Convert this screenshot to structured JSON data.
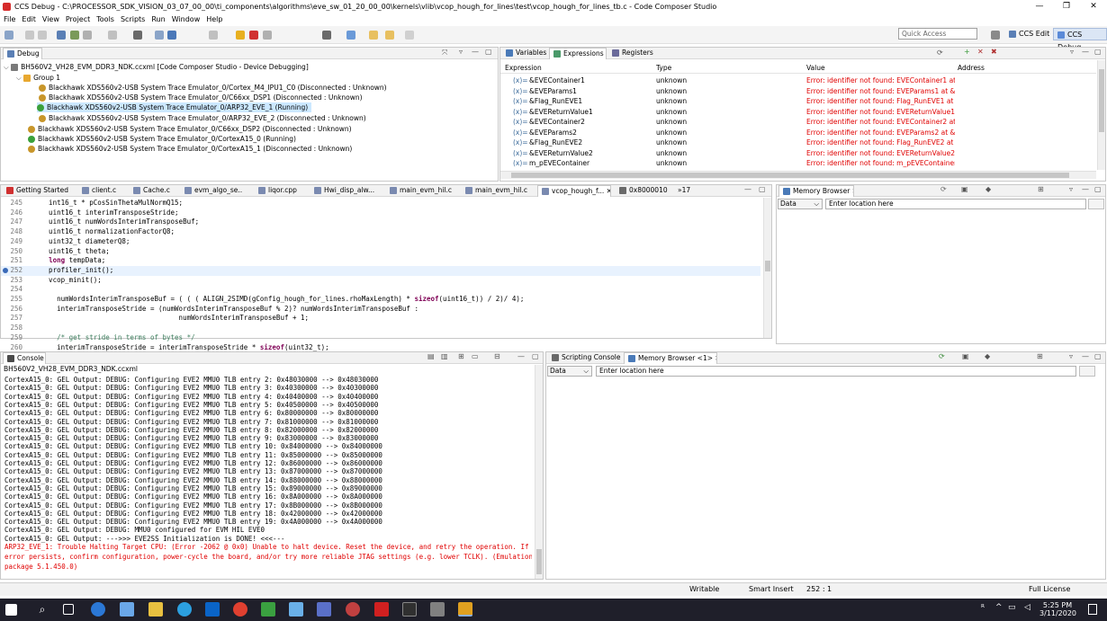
{
  "window": {
    "title": "CCS Debug - C:\\PROCESSOR_SDK_VISION_03_07_00_00\\ti_components\\algorithms\\eve_sw_01_20_00_00\\kernels\\vlib\\vcop_hough_for_lines\\test\\vcop_hough_for_lines_tb.c - Code Composer Studio",
    "minimize": "—",
    "maximize": "❐",
    "close": "✕"
  },
  "menu": [
    "File",
    "Edit",
    "View",
    "Project",
    "Tools",
    "Scripts",
    "Run",
    "Window",
    "Help"
  ],
  "toolbar": {
    "quick_access_placeholder": "Quick Access",
    "ccs_edit_label": "CCS Edit",
    "ccs_debug_label": "CCS Debug"
  },
  "debug_view": {
    "tab_label": "Debug",
    "root": "BH560V2_VH28_EVM_DDR3_NDK.ccxml [Code Composer Studio - Device Debugging]",
    "group": "Group 1",
    "group_items": [
      "Blackhawk XDS560v2-USB System Trace Emulator_0/Cortex_M4_IPU1_C0 (Disconnected : Unknown)",
      "Blackhawk XDS560v2-USB System Trace Emulator_0/C66xx_DSP1 (Disconnected : Unknown)",
      "Blackhawk XDS560v2-USB System Trace Emulator_0/ARP32_EVE_1 (Running)",
      "Blackhawk XDS560v2-USB System Trace Emulator_0/ARP32_EVE_2 (Disconnected : Unknown)"
    ],
    "other_items": [
      "Blackhawk XDS560v2-USB System Trace Emulator_0/C66xx_DSP2 (Disconnected : Unknown)",
      "Blackhawk XDS560v2-USB System Trace Emulator_0/CortexA15_0 (Running)",
      "Blackhawk XDS560v2-USB System Trace Emulator_0/CortexA15_1 (Disconnected : Unknown)"
    ]
  },
  "expressions_view": {
    "tabs": [
      "Variables",
      "Expressions",
      "Registers"
    ],
    "columns": [
      "Expression",
      "Type",
      "Value",
      "Address"
    ],
    "rows": [
      {
        "expr": "&EVEContainer1",
        "type": "unknown",
        "value": "Error: identifier not found: EVEContainer1 at &(..."
      },
      {
        "expr": "&EVEParams1",
        "type": "unknown",
        "value": "Error: identifier not found: EVEParams1 at &(E..."
      },
      {
        "expr": "&Flag_RunEVE1",
        "type": "unknown",
        "value": "Error: identifier not found: Flag_RunEVE1 at &(..."
      },
      {
        "expr": "&EVEReturnValue1",
        "type": "unknown",
        "value": "Error: identifier not found: EVEReturnValue1 at ..."
      },
      {
        "expr": "&EVEContainer2",
        "type": "unknown",
        "value": "Error: identifier not found: EVEContainer2 at &(..."
      },
      {
        "expr": "&EVEParams2",
        "type": "unknown",
        "value": "Error: identifier not found: EVEParams2 at &(E..."
      },
      {
        "expr": "&Flag_RunEVE2",
        "type": "unknown",
        "value": "Error: identifier not found: Flag_RunEVE2 at &(..."
      },
      {
        "expr": "&EVEReturnValue2",
        "type": "unknown",
        "value": "Error: identifier not found: EVEReturnValue2 at ..."
      },
      {
        "expr": "m_pEVEContainer",
        "type": "unknown",
        "value": "Error: identifier not found: m_pEVEContainer"
      }
    ]
  },
  "editor": {
    "tabs": [
      "Getting Started",
      "client.c",
      "Cache.c",
      "evm_algo_se...",
      "liqor.cpp",
      "Hwi_disp_alw...",
      "main_evm_hil.c",
      "main_evm_hil.c",
      "vcop_hough_f...",
      "0x80000102",
      "»17"
    ],
    "lines": [
      {
        "n": "245",
        "t": "    int16_t * pCosSinThetaMulNormQ15;"
      },
      {
        "n": "246",
        "t": "    uint16_t interimTransposeStride;"
      },
      {
        "n": "247",
        "t": "    uint16_t numWordsInterimTransposeBuf;"
      },
      {
        "n": "248",
        "t": "    uint16_t normalizationFactorQ8;"
      },
      {
        "n": "249",
        "t": "    uint32_t diameterQ8;"
      },
      {
        "n": "250",
        "t": "    uint16_t theta;"
      },
      {
        "n": "251",
        "t": "    long tempData;"
      },
      {
        "n": "252",
        "t": "    profiler_init();"
      },
      {
        "n": "253",
        "t": "    vcop_minit();"
      },
      {
        "n": "254",
        "t": ""
      },
      {
        "n": "255",
        "t": "      numWordsInterimTransposeBuf = ( ( ( ALIGN_2SIMD(gConfig_hough_for_lines.rhoMaxLength) * sizeof(uint16_t)) / 2)/ 4);"
      },
      {
        "n": "256",
        "t": "      interimTransposeStride = (numWordsInterimTransposeBuf % 2)? numWordsInterimTransposeBuf :"
      },
      {
        "n": "257",
        "t": "                                    numWordsInterimTransposeBuf + 1;"
      },
      {
        "n": "258",
        "t": ""
      },
      {
        "n": "259",
        "t": "      /* get stride in terms of bytes */"
      },
      {
        "n": "260",
        "t": "      interimTransposeStride = interimTransposeStride * sizeof(uint32_t);"
      }
    ]
  },
  "memory_browser": {
    "tab_label": "Memory Browser",
    "type": "Data",
    "location_placeholder": "Enter location here"
  },
  "console": {
    "tab_label": "Console",
    "subtitle": "BH560V2_VH28_EVM_DDR3_NDK.ccxml",
    "lines": [
      "CortexA15_0: GEL Output: DEBUG: Configuring EVE2 MMU0 TLB entry 2: 0x48030000 --> 0x48030000",
      "CortexA15_0: GEL Output: DEBUG: Configuring EVE2 MMU0 TLB entry 3: 0x40300000 --> 0x40300000",
      "CortexA15_0: GEL Output: DEBUG: Configuring EVE2 MMU0 TLB entry 4: 0x40400000 --> 0x40400000",
      "CortexA15_0: GEL Output: DEBUG: Configuring EVE2 MMU0 TLB entry 5: 0x40500000 --> 0x40500000",
      "CortexA15_0: GEL Output: DEBUG: Configuring EVE2 MMU0 TLB entry 6: 0x80000000 --> 0x80000000",
      "CortexA15_0: GEL Output: DEBUG: Configuring EVE2 MMU0 TLB entry 7: 0x81000000 --> 0x81000000",
      "CortexA15_0: GEL Output: DEBUG: Configuring EVE2 MMU0 TLB entry 8: 0x82000000 --> 0x82000000",
      "CortexA15_0: GEL Output: DEBUG: Configuring EVE2 MMU0 TLB entry 9: 0x83000000 --> 0x83000000",
      "CortexA15_0: GEL Output: DEBUG: Configuring EVE2 MMU0 TLB entry 10: 0x84000000 --> 0x84000000",
      "CortexA15_0: GEL Output: DEBUG: Configuring EVE2 MMU0 TLB entry 11: 0x85000000 --> 0x85000000",
      "CortexA15_0: GEL Output: DEBUG: Configuring EVE2 MMU0 TLB entry 12: 0x86000000 --> 0x86000000",
      "CortexA15_0: GEL Output: DEBUG: Configuring EVE2 MMU0 TLB entry 13: 0x87000000 --> 0x87000000",
      "CortexA15_0: GEL Output: DEBUG: Configuring EVE2 MMU0 TLB entry 14: 0x88000000 --> 0x88000000",
      "CortexA15_0: GEL Output: DEBUG: Configuring EVE2 MMU0 TLB entry 15: 0x89000000 --> 0x89000000",
      "CortexA15_0: GEL Output: DEBUG: Configuring EVE2 MMU0 TLB entry 16: 0x8A000000 --> 0x8A000000",
      "CortexA15_0: GEL Output: DEBUG: Configuring EVE2 MMU0 TLB entry 17: 0x8B000000 --> 0x8B000000",
      "CortexA15_0: GEL Output: DEBUG: Configuring EVE2 MMU0 TLB entry 18: 0x42000000 --> 0x42000000",
      "CortexA15_0: GEL Output: DEBUG: Configuring EVE2 MMU0 TLB entry 19: 0x4A000000 --> 0x4A000000",
      "CortexA15_0: GEL Output: DEBUG: MMU0 configured for EVM HIL EVE0",
      "CortexA15_0: GEL Output: --->>> EVE2SS Initialization is DONE! <<<---"
    ],
    "error_lines": [
      "ARP32_EVE_1: Trouble Halting Target CPU: (Error -2062 @ 0x0) Unable to halt device. Reset the device, and retry the operation. If",
      "error persists, confirm configuration, power-cycle the board, and/or try more reliable JTAG settings (e.g. lower TCLK). (Emulation",
      "package 5.1.450.0)"
    ]
  },
  "bottom_right": {
    "tabs": [
      "Scripting Console",
      "Memory Browser <1>"
    ],
    "type": "Data",
    "location_placeholder": "Enter location here"
  },
  "statusbar": {
    "writable": "Writable",
    "insert": "Smart Insert",
    "position": "252 : 1",
    "license": "Full License"
  },
  "taskbar": {
    "time": "5:25 PM",
    "date": "3/11/2020"
  },
  "colors": {
    "error": "#e00000",
    "keyword": "#7f0055",
    "comment": "#3f7f5f",
    "selection": "#cce8ff"
  }
}
